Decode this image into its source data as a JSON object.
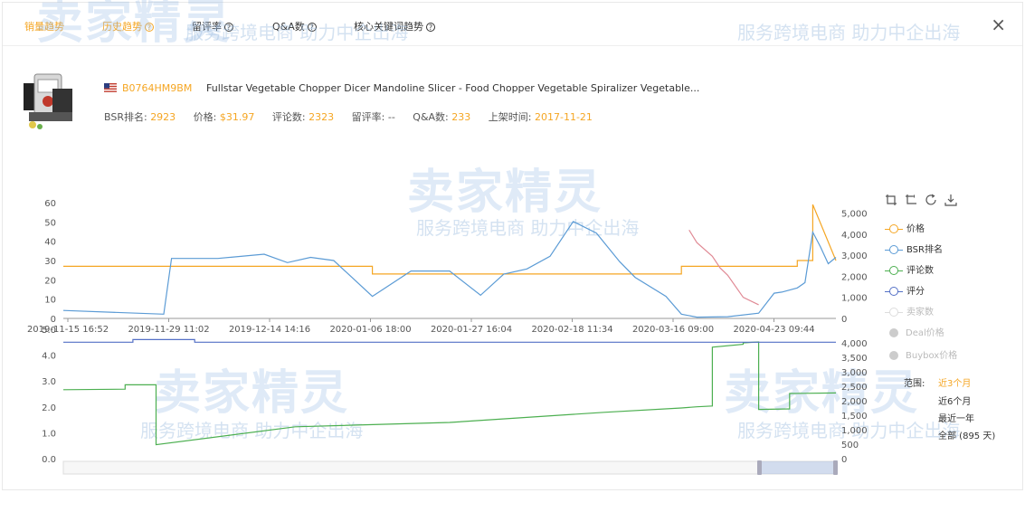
{
  "tabs": [
    {
      "label": "销量趋势",
      "help": false,
      "style": "orange"
    },
    {
      "label": "历史趋势",
      "help": true,
      "style": "active"
    },
    {
      "label": "留评率",
      "help": true,
      "style": ""
    },
    {
      "label": "Q&A数",
      "help": true,
      "style": ""
    },
    {
      "label": "核心关键词趋势",
      "help": true,
      "style": ""
    }
  ],
  "close_label": "×",
  "product": {
    "asin": "B0764HM9BM",
    "title": "Fullstar Vegetable Chopper Dicer Mandoline Slicer - Food Chopper Vegetable Spiralizer Vegetable...",
    "metrics": [
      {
        "label": "BSR排名:",
        "value": "2923"
      },
      {
        "label": "价格:",
        "value": "$31.97"
      },
      {
        "label": "评论数:",
        "value": "2323"
      },
      {
        "label": "留评率:",
        "value": "--"
      },
      {
        "label": "Q&A数:",
        "value": "233"
      },
      {
        "label": "上架时间:",
        "value": "2017-11-21"
      }
    ]
  },
  "toolbar_icons": [
    "zoom-in-icon",
    "zoom-reset-icon",
    "refresh-icon",
    "download-icon"
  ],
  "legend": [
    {
      "label": "价格",
      "color": "#f5a623",
      "dim": false
    },
    {
      "label": "BSR排名",
      "color": "#5b9bd5",
      "dim": false
    },
    {
      "label": "评论数",
      "color": "#4caf50",
      "dim": false
    },
    {
      "label": "评分",
      "color": "#5470c6",
      "dim": false
    },
    {
      "label": "卖家数",
      "color": "#cccccc",
      "dim": true
    },
    {
      "label": "Deal价格",
      "color": "#cccccc",
      "dim": true,
      "dot": true
    },
    {
      "label": "Buybox价格",
      "color": "#cccccc",
      "dim": true,
      "dot": true
    }
  ],
  "range": {
    "label": "范围:",
    "options": [
      "近3个月",
      "近6个月",
      "最近一年",
      "全部 (895 天)"
    ],
    "selected": 0
  },
  "watermark": {
    "brand": "卖家精灵",
    "slogan": "服务跨境电商 助力中企出海"
  },
  "chart_data": [
    {
      "type": "line",
      "x_ticks": [
        "2019-11-15 16:52",
        "2019-11-29 11:02",
        "2019-12-14 14:16",
        "2020-01-06 18:00",
        "2020-01-27 16:04",
        "2020-02-18 11:34",
        "2020-03-16 09:00",
        "2020-04-23 09:44"
      ],
      "y_left_ticks": [
        "60",
        "50",
        "40",
        "30",
        "20",
        "10",
        "0"
      ],
      "y_left_range": [
        0,
        60
      ],
      "y_right_ticks": [
        "5,000",
        "4,000",
        "3,000",
        "2,000",
        "1,000",
        "0"
      ],
      "y_right_range": [
        0,
        5500
      ],
      "series": [
        {
          "name": "价格",
          "axis": "left",
          "color": "#f5a623",
          "x": [
            0,
            0.4,
            0.4,
            0.8,
            0.8,
            0.95,
            0.95,
            0.97,
            0.97,
            1.0
          ],
          "values": [
            27,
            27,
            23,
            23,
            27,
            27,
            30,
            30,
            59,
            30
          ]
        },
        {
          "name": "BSR排名",
          "axis": "right",
          "color": "#5b9bd5",
          "x": [
            0,
            0.13,
            0.14,
            0.2,
            0.26,
            0.29,
            0.32,
            0.35,
            0.4,
            0.45,
            0.5,
            0.54,
            0.57,
            0.6,
            0.63,
            0.66,
            0.69,
            0.72,
            0.74,
            0.78,
            0.8,
            0.82,
            0.86,
            0.9,
            0.92,
            0.93,
            0.95,
            0.96,
            0.97,
            0.98,
            0.99,
            1.0
          ],
          "values": [
            380,
            200,
            2850,
            2850,
            3050,
            2650,
            2900,
            2750,
            1050,
            2250,
            2250,
            1100,
            2100,
            2350,
            2950,
            4600,
            4050,
            2700,
            1950,
            1050,
            200,
            60,
            80,
            250,
            1200,
            1250,
            1450,
            1700,
            4100,
            3400,
            2600,
            2900
          ]
        },
        {
          "name": "BSR排名(高亮)",
          "axis": "right",
          "color": "#e08a95",
          "x": [
            0.81,
            0.82,
            0.84,
            0.85,
            0.86,
            0.88,
            0.9
          ],
          "values": [
            4200,
            3600,
            2950,
            2400,
            2050,
            1000,
            650
          ]
        }
      ]
    },
    {
      "type": "line",
      "y_left_ticks": [
        "5.0",
        "4.0",
        "3.0",
        "2.0",
        "1.0",
        "0.0"
      ],
      "y_left_range": [
        0,
        5
      ],
      "y_right_ticks": [
        "4,000",
        "3,500",
        "3,000",
        "2,500",
        "2,000",
        "1,500",
        "1,000",
        "500",
        "0"
      ],
      "y_right_range": [
        0,
        4000
      ],
      "series": [
        {
          "name": "评论数",
          "axis": "right",
          "color": "#4caf50",
          "x": [
            0,
            0.08,
            0.08,
            0.12,
            0.12,
            0.3,
            0.5,
            0.7,
            0.8,
            0.82,
            0.84,
            0.84,
            0.88,
            0.88,
            0.9,
            0.9,
            0.94,
            0.94,
            1.0
          ],
          "values": [
            2380,
            2400,
            2550,
            2550,
            480,
            1100,
            1250,
            1600,
            1750,
            1790,
            1820,
            3850,
            3950,
            4000,
            4030,
            1700,
            1720,
            2250,
            2270
          ]
        },
        {
          "name": "评分",
          "axis": "left",
          "color": "#5470c6",
          "x": [
            0,
            0.09,
            0.09,
            0.17,
            0.17,
            0.45,
            0.8,
            0.92,
            1.0
          ],
          "values": [
            4.5,
            4.5,
            4.6,
            4.6,
            4.5,
            4.5,
            4.5,
            4.5,
            4.5
          ]
        }
      ]
    }
  ]
}
